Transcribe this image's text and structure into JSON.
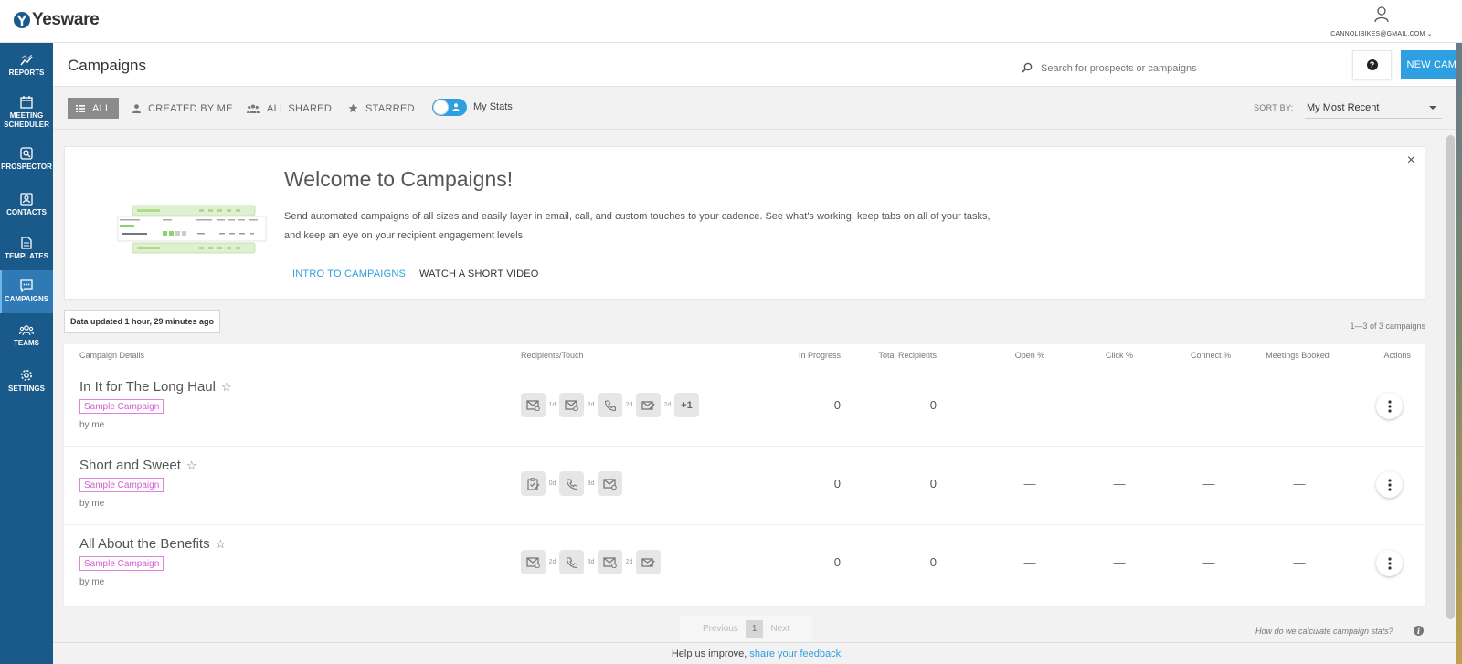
{
  "app": {
    "logo_text": "Yesware"
  },
  "user": {
    "email": "CANNOLIBIKES@GMAIL.COM"
  },
  "sidebar": {
    "items": [
      {
        "label": "REPORTS",
        "icon": "reports-icon"
      },
      {
        "label_line1": "MEETING",
        "label_line2": "SCHEDULER",
        "icon": "calendar-icon"
      },
      {
        "label": "PROSPECTOR",
        "icon": "prospector-icon"
      },
      {
        "label": "CONTACTS",
        "icon": "contacts-icon"
      },
      {
        "label": "TEMPLATES",
        "icon": "templates-icon"
      },
      {
        "label": "CAMPAIGNS",
        "icon": "campaigns-icon",
        "active": true
      },
      {
        "label": "TEAMS",
        "icon": "teams-icon"
      },
      {
        "label": "SETTINGS",
        "icon": "settings-icon"
      }
    ]
  },
  "header": {
    "title": "Campaigns",
    "search_placeholder": "Search for prospects or campaigns",
    "help_label": "?",
    "new_campaign_label": "NEW CAMPAIGN"
  },
  "filters": {
    "all": "ALL",
    "created_by_me": "CREATED BY ME",
    "all_shared": "ALL SHARED",
    "starred": "STARRED",
    "my_stats_label": "My Stats",
    "my_stats_on": true,
    "sort_by_label": "SORT BY:",
    "sort_value": "My Most Recent"
  },
  "welcome": {
    "title": "Welcome to Campaigns!",
    "description": "Send automated campaigns of all sizes and easily layer in email, call, and custom touches to your cadence. See what's working, keep tabs on all of your tasks, and keep an eye on your recipient engagement levels.",
    "link_intro": "INTRO TO CAMPAIGNS",
    "link_video": "WATCH A SHORT VIDEO",
    "close": "×"
  },
  "status": {
    "updated": "Data updated 1 hour, 29 minutes ago",
    "range": "1—3 of 3 campaigns"
  },
  "table": {
    "headers": {
      "details": "Campaign Details",
      "touch": "Recipients/Touch",
      "in_progress": "In Progress",
      "total": "Total Recipients",
      "open": "Open %",
      "click": "Click %",
      "connect": "Connect %",
      "meetings": "Meetings Booked",
      "actions": "Actions"
    },
    "rows": [
      {
        "name": "In It for The Long Haul",
        "badge": "Sample Campaign",
        "by": "by me",
        "touches": [
          {
            "icon": "email-icon",
            "delay": "1d"
          },
          {
            "icon": "email-icon",
            "delay": "2d"
          },
          {
            "icon": "phone-icon",
            "delay": "2d"
          },
          {
            "icon": "email-edit-icon",
            "delay": "2d"
          },
          {
            "icon": "more-touches",
            "label": "+1"
          }
        ],
        "in_progress": "0",
        "total": "0",
        "open": "—",
        "click": "—",
        "connect": "—",
        "meetings": "—"
      },
      {
        "name": "Short and Sweet",
        "badge": "Sample Campaign",
        "by": "by me",
        "touches": [
          {
            "icon": "task-icon",
            "delay": "0d"
          },
          {
            "icon": "phone-icon",
            "delay": "3d"
          },
          {
            "icon": "email-icon"
          }
        ],
        "in_progress": "0",
        "total": "0",
        "open": "—",
        "click": "—",
        "connect": "—",
        "meetings": "—"
      },
      {
        "name": "All About the Benefits",
        "badge": "Sample Campaign",
        "by": "by me",
        "touches": [
          {
            "icon": "email-icon",
            "delay": "2d"
          },
          {
            "icon": "phone-icon",
            "delay": "3d"
          },
          {
            "icon": "email-icon",
            "delay": "2d"
          },
          {
            "icon": "email-edit-icon"
          }
        ],
        "in_progress": "0",
        "total": "0",
        "open": "—",
        "click": "—",
        "connect": "—",
        "meetings": "—"
      }
    ]
  },
  "pagination": {
    "previous": "Previous",
    "current": "1",
    "next": "Next"
  },
  "calc_link": "How do we calculate campaign stats?",
  "calc_icon": "i",
  "footer": {
    "text": "Help us improve, ",
    "link": "share your feedback."
  },
  "colors": {
    "sidebar": "#1a5a8a",
    "accent": "#2e9fe0",
    "badge": "#d060d0"
  }
}
